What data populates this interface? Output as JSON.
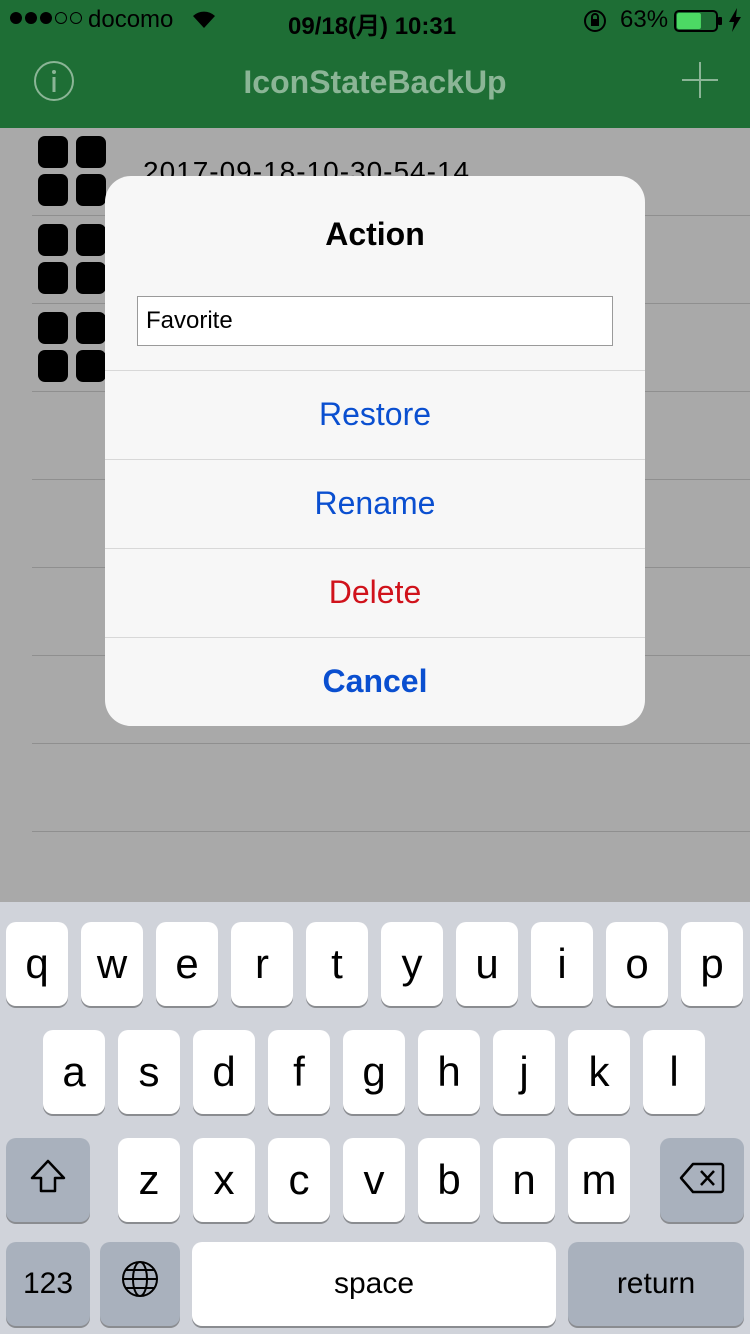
{
  "status_bar": {
    "carrier": "docomo",
    "time": "09/18(月) 10:31",
    "battery_percent": "63%",
    "signal_bars": 3,
    "signal_total": 5,
    "battery_level": 0.63
  },
  "nav": {
    "title": "IconStateBackUp",
    "left_icon": "info-icon",
    "right_icon": "plus-icon"
  },
  "list": {
    "rows": [
      {
        "label": "2017-09-18-10-30-54-14"
      },
      {
        "label": ""
      },
      {
        "label": ""
      }
    ],
    "empty_rows": 5
  },
  "alert": {
    "title": "Action",
    "input_value": "Favorite",
    "buttons": {
      "restore": "Restore",
      "rename": "Rename",
      "delete": "Delete",
      "cancel": "Cancel"
    }
  },
  "keyboard": {
    "row1": [
      "q",
      "w",
      "e",
      "r",
      "t",
      "y",
      "u",
      "i",
      "o",
      "p"
    ],
    "row2": [
      "a",
      "s",
      "d",
      "f",
      "g",
      "h",
      "j",
      "k",
      "l"
    ],
    "row3": [
      "z",
      "x",
      "c",
      "v",
      "b",
      "n",
      "m"
    ],
    "numbers_label": "123",
    "space_label": "space",
    "return_label": "return",
    "shift_icon": "shift-icon",
    "delete_icon": "backspace-icon",
    "globe_icon": "globe-icon"
  },
  "colors": {
    "nav_bg": "#1e6e35",
    "alert_action": "#0a4fd0",
    "alert_destructive": "#d0121b",
    "keyboard_bg": "#d0d3da"
  }
}
